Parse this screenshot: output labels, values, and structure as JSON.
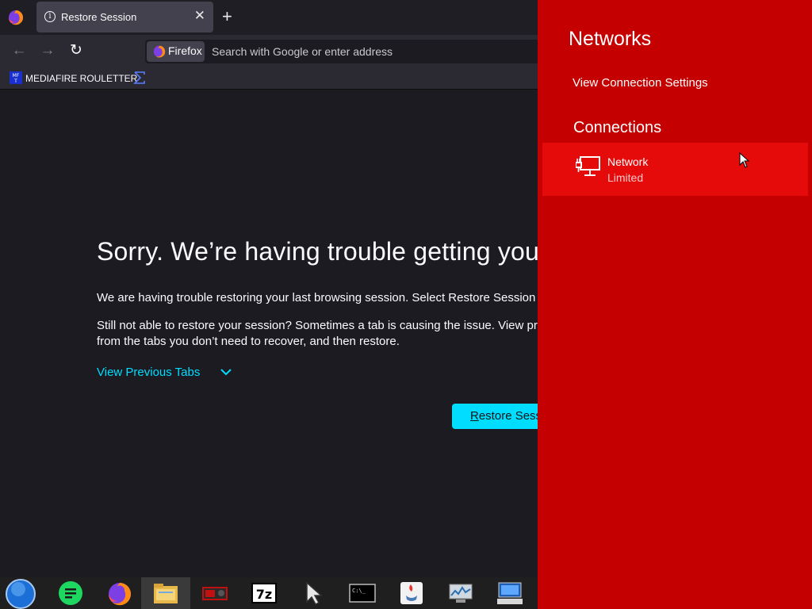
{
  "browser": {
    "tab": {
      "title": "Restore Session",
      "close_glyph": "✕"
    },
    "new_tab_glyph": "+",
    "nav": {
      "back_glyph": "←",
      "forward_glyph": "→",
      "reload_glyph": "↻"
    },
    "urlbar": {
      "identity_label": "Firefox",
      "placeholder": "Search with Google or enter address"
    },
    "bookmarks": [
      {
        "label": "MEDIAFIRE ROULETTER",
        "icon": "mediafire-icon"
      },
      {
        "label": "",
        "icon": "sigma-icon"
      }
    ]
  },
  "page": {
    "headline": "Sorry. We’re having trouble getting your",
    "para1": "We are having trouble restoring your last browsing session. Select Restore Session to",
    "para2_line1": "Still not able to restore your session? Sometimes a tab is causing the issue. View prev",
    "para2_line2": "from the tabs you don’t need to recover, and then restore.",
    "view_previous_tabs": "View Previous Tabs",
    "restore_button": {
      "underlined": "R",
      "rest": "estore Sess"
    },
    "accent": "#00ddff"
  },
  "taskbar": {
    "items": [
      "start-orb-icon",
      "notes-app-icon",
      "firefox-icon",
      "file-explorer-icon",
      "video-card-icon",
      "7zip-icon",
      "cursor-app-icon",
      "terminal-icon",
      "java-icon",
      "system-monitor-icon",
      "remote-desktop-icon"
    ],
    "sevenzip_label": "7z",
    "terminal_label": "C:\\_"
  },
  "networks_panel": {
    "title": "Networks",
    "link": "View Connection Settings",
    "section": "Connections",
    "network": {
      "name": "Network",
      "status": "Limited"
    },
    "colors": {
      "panel": "#c50000",
      "item": "#e60b0b"
    }
  }
}
